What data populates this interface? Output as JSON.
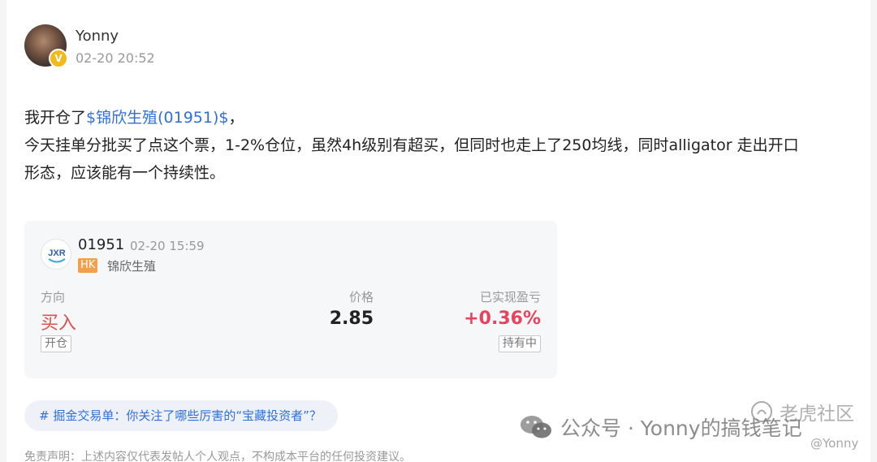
{
  "post": {
    "author": {
      "name": "Yonny",
      "verified_mark": "V",
      "timestamp": "02-20 20:52"
    },
    "content": {
      "line1_prefix": "我开仓了",
      "stock_link": "$锦欣生殖(01951)$",
      "line1_suffix": "，",
      "line2": "今天挂单分批买了点这个票，1-2%仓位，虽然4h级别有超买，但同时也走上了250均线，同时alligator 走出开口",
      "line3": "形态，应该能有一个持续性。"
    },
    "trade_card": {
      "logo_text": "JXR",
      "code": "01951",
      "time": "02-20 15:59",
      "market_tag": "HK",
      "stock_name": "锦欣生殖",
      "direction_label": "方向",
      "direction_value": "买入",
      "direction_tag": "开仓",
      "price_label": "价格",
      "price_value": "2.85",
      "pnl_label": "已实现盈亏",
      "pnl_value": "+0.36%",
      "pnl_tag": "持有中"
    },
    "topic": "# 掘金交易单：你关注了哪些厉害的“宝藏投资者”？",
    "disclaimer": "免责声明：上述内容仅代表发帖人个人观点，不构成本平台的任何投资建议。"
  },
  "watermarks": {
    "wechat": "公众号 · Yonny的搞钱笔记",
    "community": "老虎社区",
    "handle": "@Yonny"
  },
  "colors": {
    "link": "#2f6fdc",
    "buy": "#d9534f",
    "profit": "#e5445c",
    "market_tag": "#f2a04a"
  },
  "icons": [
    "wechat-icon",
    "tiger-icon",
    "verified-badge-icon"
  ]
}
